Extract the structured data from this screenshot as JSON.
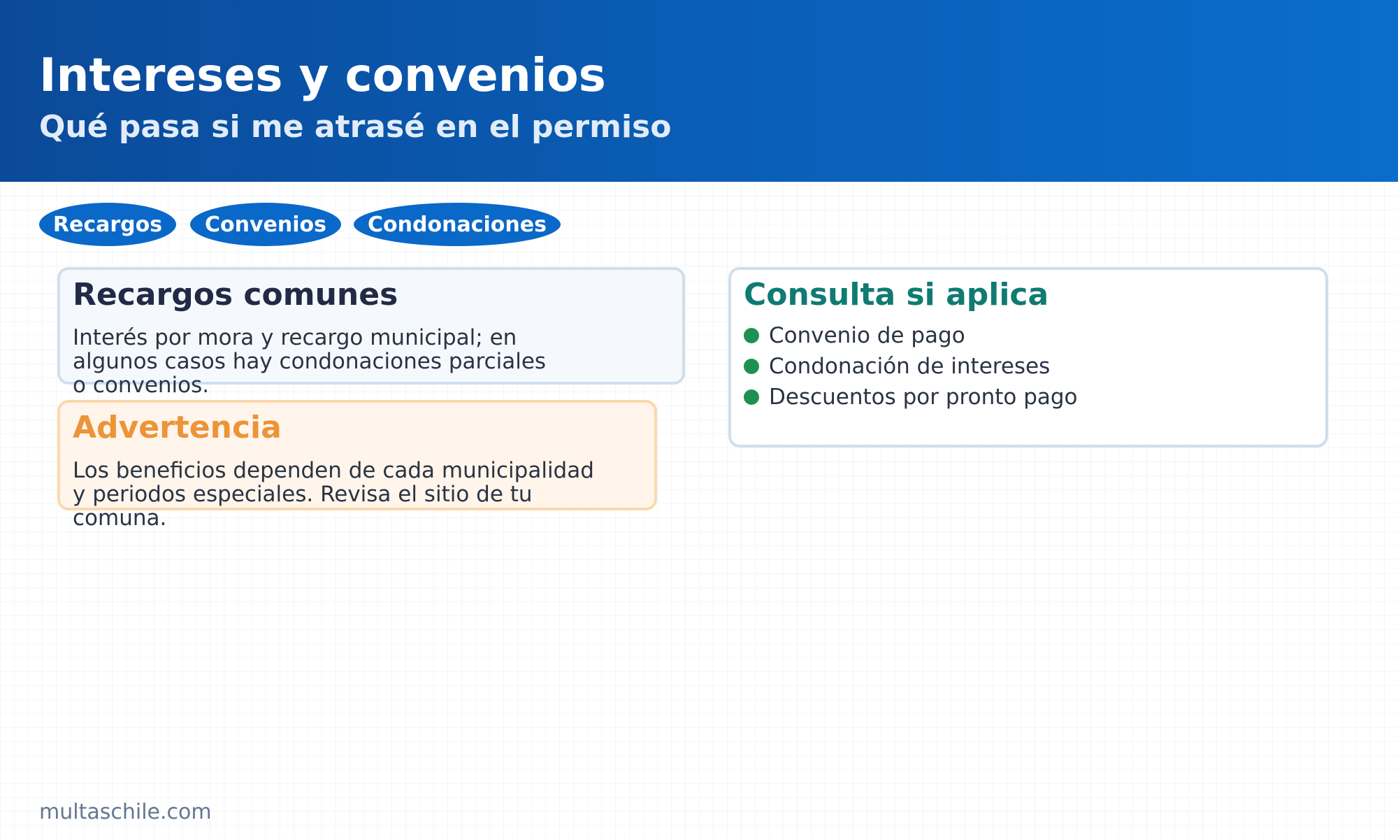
{
  "header": {
    "title": "Intereses y convenios",
    "subtitle": "Qué pasa si me atrasé en el permiso"
  },
  "tags": [
    "Recargos",
    "Convenios",
    "Condonaciones"
  ],
  "cards": {
    "recargos": {
      "title": "Recargos comunes",
      "lines": [
        "Interés por mora y recargo municipal; en",
        "algunos casos hay condonaciones parciales",
        "o convenios."
      ]
    },
    "advertencia": {
      "title": "Advertencia",
      "lines": [
        "Los beneficios dependen de cada municipalidad",
        "y periodos especiales. Revisa el sitio de tu",
        "comuna."
      ]
    },
    "consulta": {
      "title": "Consulta si aplica",
      "items": [
        "Convenio de pago",
        "Condonación de intereses",
        "Descuentos por pronto pago"
      ]
    }
  },
  "footer": {
    "site": "multaschile.com"
  },
  "colors": {
    "header_start": "#0b4a99",
    "header_end": "#0a6dcc",
    "tag_bg": "#0a68c8",
    "title_dark": "#222a45",
    "warning_orange": "#ec9438",
    "teal": "#0f7b72",
    "bullet_green": "#1e9150"
  }
}
